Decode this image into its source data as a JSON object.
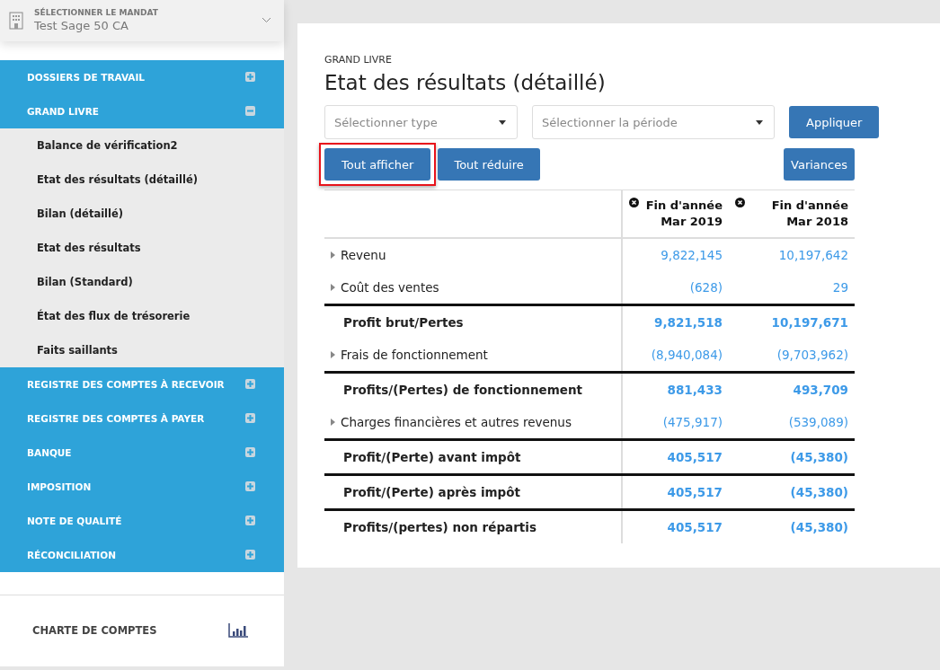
{
  "mandate": {
    "label": "SÉLECTIONNER LE MANDAT",
    "value": "Test Sage 50 CA"
  },
  "nav": [
    {
      "label": "DOSSIERS DE TRAVAIL",
      "expanded": false
    },
    {
      "label": "GRAND LIVRE",
      "expanded": true,
      "children": [
        {
          "label": "Balance de vérification2"
        },
        {
          "label": "Etat des résultats (détaillé)"
        },
        {
          "label": "Bilan (détaillé)"
        },
        {
          "label": "Etat des résultats"
        },
        {
          "label": "Bilan (Standard)"
        },
        {
          "label": "État des flux de trésorerie"
        },
        {
          "label": "Faits saillants"
        }
      ]
    },
    {
      "label": "REGISTRE DES COMPTES À RECEVOIR",
      "expanded": false
    },
    {
      "label": "REGISTRE DES COMPTES À PAYER",
      "expanded": false
    },
    {
      "label": "BANQUE",
      "expanded": false
    },
    {
      "label": "IMPOSITION",
      "expanded": false
    },
    {
      "label": "NOTE DE QUALITÉ",
      "expanded": false
    },
    {
      "label": "RÉCONCILIATION",
      "expanded": false
    }
  ],
  "footer": {
    "label": "CHARTE DE COMPTES"
  },
  "breadcrumb": "GRAND LIVRE",
  "title": "Etat des résultats (détaillé)",
  "filters": [
    {
      "placeholder": "Sélectionner type"
    },
    {
      "placeholder": "Sélectionner la période"
    }
  ],
  "apply_button": "Appliquer",
  "actions": [
    {
      "label": "Tout afficher",
      "highlighted": true
    },
    {
      "label": "Tout réduire",
      "highlighted": false
    }
  ],
  "variances_button": "Variances",
  "table": {
    "columns": [
      {
        "line1": "Fin d'année",
        "line2": "Mar 2019"
      },
      {
        "line1": "Fin d'année",
        "line2": "Mar 2018"
      }
    ],
    "rows": [
      {
        "kind": "detail",
        "label": "Revenu",
        "values": [
          "9,822,145",
          "10,197,642"
        ]
      },
      {
        "kind": "detail",
        "label": "Coût des ventes",
        "values": [
          "(628)",
          "29"
        ]
      },
      {
        "kind": "total",
        "label": "Profit brut/Pertes",
        "values": [
          "9,821,518",
          "10,197,671"
        ]
      },
      {
        "kind": "detail",
        "label": "Frais de fonctionnement",
        "values": [
          "(8,940,084)",
          "(9,703,962)"
        ]
      },
      {
        "kind": "total",
        "label": "Profits/(Pertes) de fonctionnement",
        "values": [
          "881,433",
          "493,709"
        ]
      },
      {
        "kind": "detail",
        "label": "Charges financières et autres revenus",
        "values": [
          "(475,917)",
          "(539,089)"
        ]
      },
      {
        "kind": "total",
        "label": "Profit/(Perte) avant impôt",
        "values": [
          "405,517",
          "(45,380)"
        ]
      },
      {
        "kind": "total",
        "label": "Profit/(Perte) après impôt",
        "values": [
          "405,517",
          "(45,380)"
        ]
      },
      {
        "kind": "total",
        "label": "Profits/(pertes) non répartis",
        "values": [
          "405,517",
          "(45,380)"
        ]
      }
    ]
  }
}
